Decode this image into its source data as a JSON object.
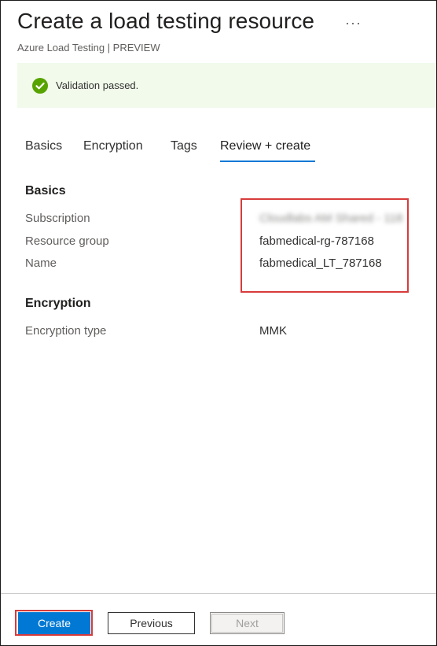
{
  "header": {
    "title": "Create a load testing resource",
    "more_icon": "ellipsis-icon",
    "subtitle": "Azure Load Testing | PREVIEW"
  },
  "banner": {
    "icon": "check-circle-icon",
    "text": "Validation passed.",
    "colors": {
      "background": "#f1faeb",
      "icon": "#57a300"
    }
  },
  "tabs": [
    {
      "label": "Basics",
      "active": false
    },
    {
      "label": "Encryption",
      "active": false
    },
    {
      "label": "Tags",
      "active": false
    },
    {
      "label": "Review + create",
      "active": true
    }
  ],
  "sections": {
    "basics": {
      "title": "Basics",
      "fields": [
        {
          "label": "Subscription",
          "value": "Cloudlabs AM Shared - 118"
        },
        {
          "label": "Resource group",
          "value": "fabmedical-rg-787168"
        },
        {
          "label": "Name",
          "value": "fabmedical_LT_787168"
        }
      ]
    },
    "encryption": {
      "title": "Encryption",
      "fields": [
        {
          "label": "Encryption type",
          "value": "MMK"
        }
      ]
    }
  },
  "footer": {
    "create_label": "Create",
    "previous_label": "Previous",
    "next_label": "Next"
  },
  "colors": {
    "accent": "#0078d4",
    "highlight": "#d83b3b"
  }
}
